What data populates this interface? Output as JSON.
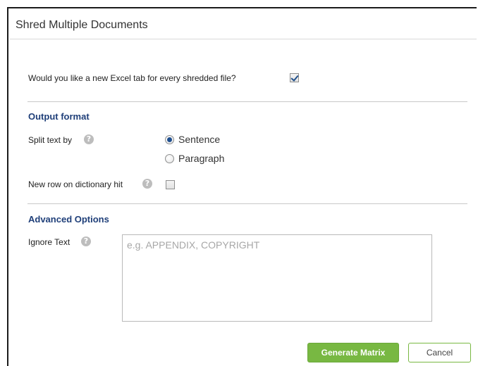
{
  "dialog": {
    "title": "Shred Multiple Documents"
  },
  "excel_tab": {
    "question": "Would you like a new Excel tab for every shredded file?",
    "checked": true
  },
  "output_format": {
    "heading": "Output format",
    "split_label": "Split text by",
    "options": [
      "Sentence",
      "Paragraph"
    ],
    "selected": "Sentence",
    "new_row_label": "New row on dictionary hit",
    "new_row_checked": false
  },
  "advanced": {
    "heading": "Advanced Options",
    "ignore_label": "Ignore Text",
    "ignore_value": "",
    "ignore_placeholder": "e.g. APPENDIX, COPYRIGHT"
  },
  "buttons": {
    "generate": "Generate Matrix",
    "cancel": "Cancel"
  },
  "icons": {
    "help": "help-icon",
    "help_glyph": "?"
  },
  "colors": {
    "accent_green": "#78b842",
    "heading_blue": "#1f3f79",
    "radio_blue": "#1f4f8f"
  }
}
